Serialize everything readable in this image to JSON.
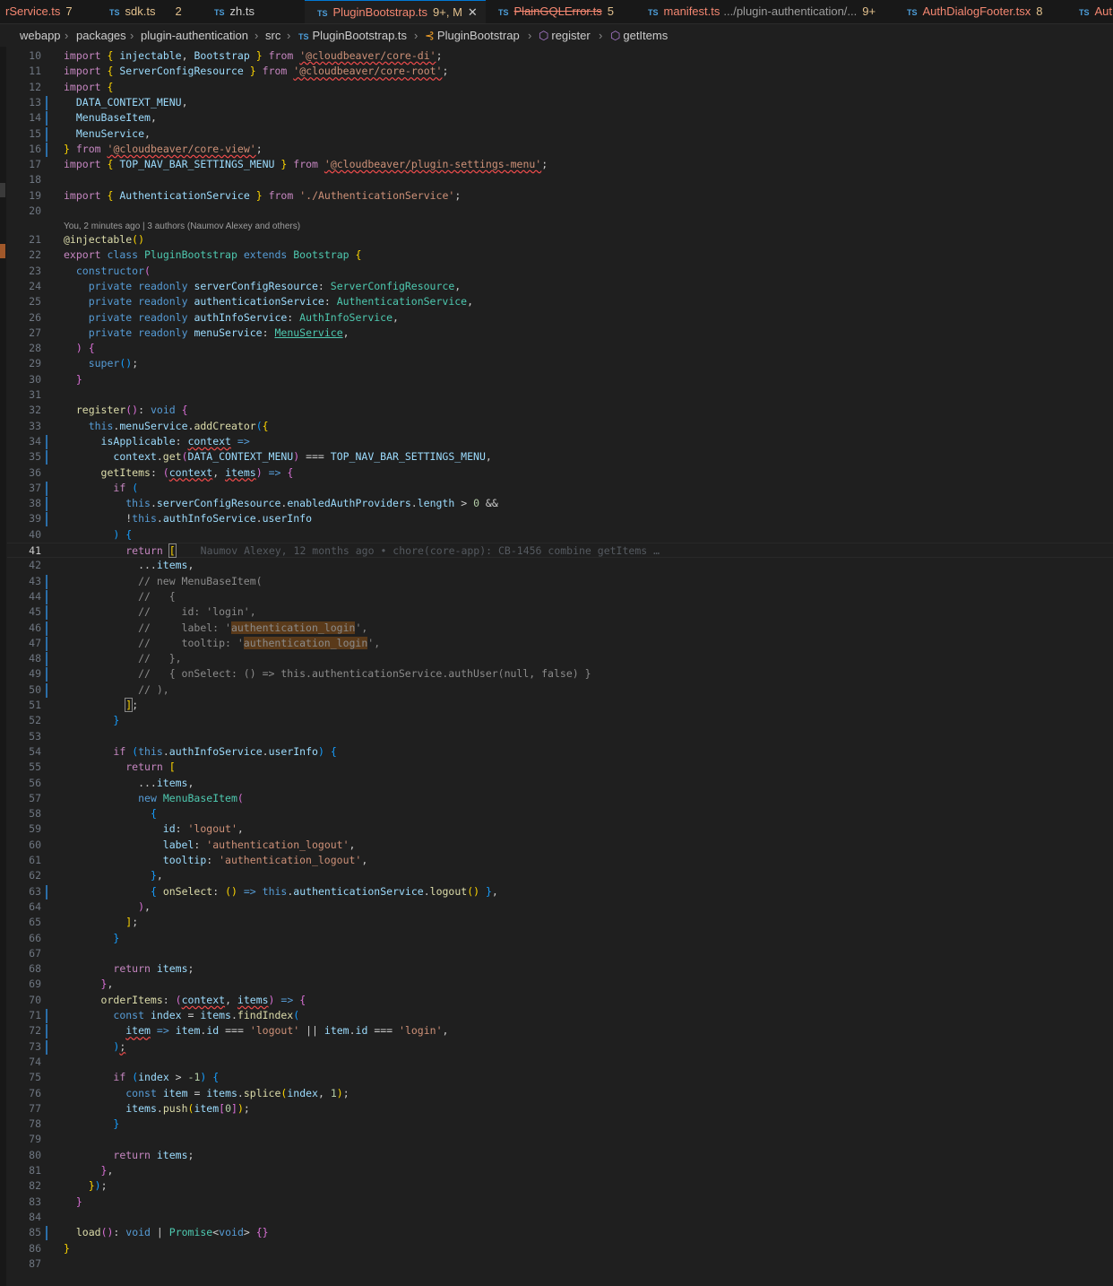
{
  "tabs": [
    {
      "name": "rService.ts",
      "badge": "7",
      "ts": false,
      "state": "err"
    },
    {
      "name": "sdk.ts",
      "badge": "2",
      "ts": true,
      "state": "err"
    },
    {
      "name": "zh.ts",
      "badge": "",
      "ts": true,
      "state": ""
    },
    {
      "name": "PluginBootstrap.ts",
      "badge": "9+, M",
      "ts": true,
      "state": "err",
      "active": true
    },
    {
      "name": "PlainGQLError.ts",
      "badge": "5",
      "ts": true,
      "state": "strike"
    },
    {
      "name": "manifest.ts",
      "desc": ".../plugin-authentication/...",
      "badge": "9+",
      "ts": true,
      "state": "err"
    },
    {
      "name": "AuthDialogFooter.tsx",
      "badge": "8",
      "ts": true,
      "state": "err"
    },
    {
      "name": "Aut",
      "badge": "",
      "ts": true,
      "state": "err"
    }
  ],
  "breadcrumb": [
    "webapp",
    "packages",
    "plugin-authentication",
    "src",
    "PluginBootstrap.ts",
    "PluginBootstrap",
    "register",
    "getItems"
  ],
  "blame_annotation": "You, 2 minutes ago | 3 authors (Naumov Alexey and others)",
  "inline_blame": "Naumov Alexey, 12 months ago • chore(core-app): CB-1456 combine getItems …",
  "current_line": 41,
  "colors": {
    "accent": "#0078d4",
    "tab_error": "#f48771",
    "modified": "#e2c08d"
  }
}
